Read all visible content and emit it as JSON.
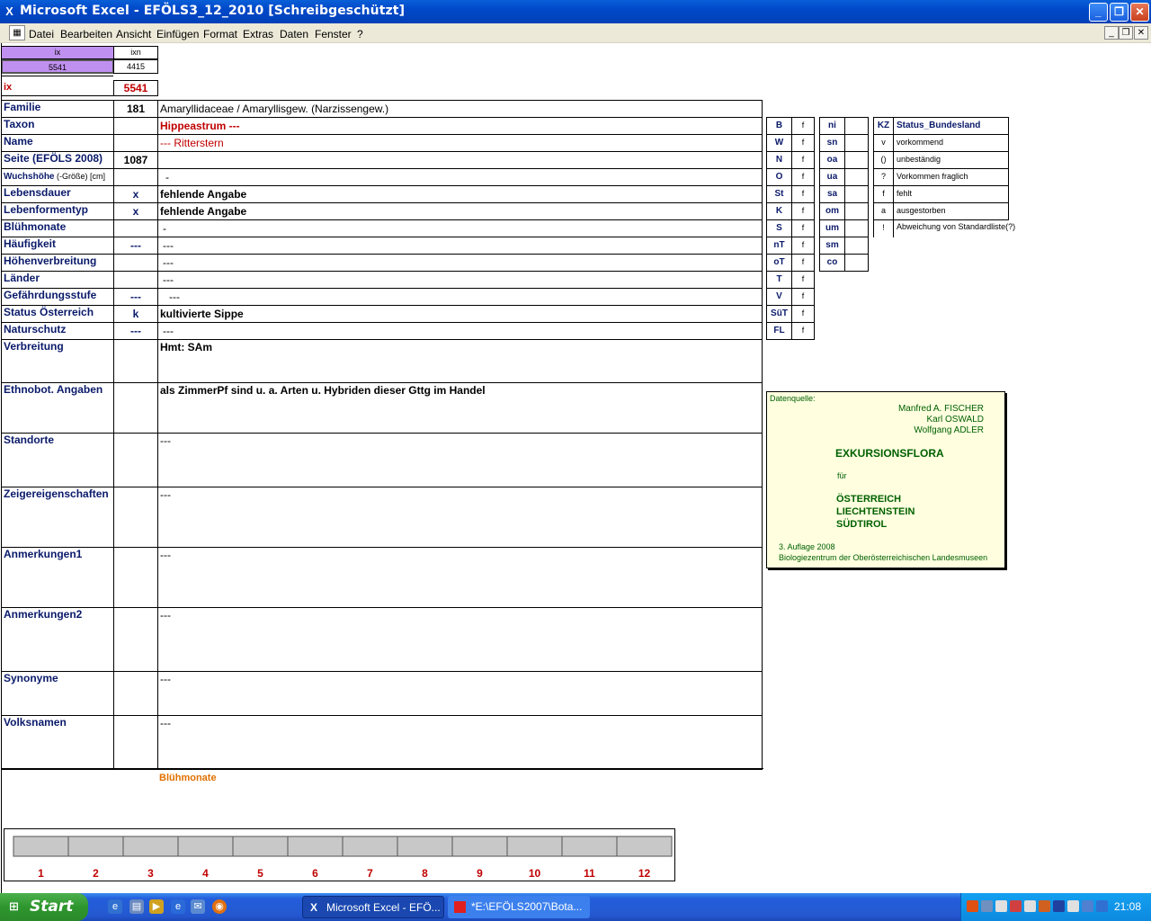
{
  "titlebar": {
    "title": "Microsoft Excel - EFÖLS3_12_2010  [Schreibgeschützt]",
    "app_icon": "excel-icon"
  },
  "menu": [
    "Datei",
    "Bearbeiten",
    "Ansicht",
    "Einfügen",
    "Format",
    "Extras",
    "Daten",
    "Fenster",
    "?"
  ],
  "index_box": {
    "ix_label": "ix",
    "ixn_label": "ixn",
    "ix_value": "5541",
    "ixn_value": "4415"
  },
  "ix_row": {
    "label": "ix",
    "value": "5541"
  },
  "rows": [
    {
      "label": "Familie",
      "code": "181",
      "value": "Amaryllidaceae  /  Amaryllisgew. (Narzissengew.)"
    },
    {
      "label": "Taxon",
      "code": "",
      "value": "Hippeastrum ---"
    },
    {
      "label": "Name",
      "code": "",
      "value": "--- Ritterstern"
    },
    {
      "label": "Seite (EFÖLS 2008)",
      "code": "1087",
      "value": ""
    },
    {
      "label": "Wuchshöhe",
      "label_suffix": " (-Größe) [cm]",
      "code": "",
      "value": "-"
    },
    {
      "label": "Lebensdauer",
      "code": "x",
      "value": "fehlende Angabe"
    },
    {
      "label": "Lebenformentyp",
      "code": "x",
      "value": "fehlende Angabe"
    },
    {
      "label": "Blühmonate",
      "code": "",
      "value": "-"
    },
    {
      "label": "Häufigkeit",
      "code": "---",
      "value": "---"
    },
    {
      "label": "Höhenverbreitung",
      "code": "",
      "value": "---"
    },
    {
      "label": "Länder",
      "code": "",
      "value": "---"
    },
    {
      "label": "Gefährdungsstufe",
      "code": "---",
      "value": "---"
    },
    {
      "label": "Status Österreich",
      "code": "k",
      "value": "kultivierte Sippe"
    },
    {
      "label": "Naturschutz",
      "code": "---",
      "value": "---"
    },
    {
      "label": "Verbreitung",
      "code": "",
      "value": "Hmt: SAm"
    },
    {
      "label": "Ethnobot. Angaben",
      "code": "",
      "value": "als ZimmerPf sind u. a. Arten u. Hybriden dieser Gttg im Handel"
    },
    {
      "label": "Standorte",
      "code": "",
      "value": "---"
    },
    {
      "label": "Zeigereigenschaften",
      "code": "",
      "value": "---"
    },
    {
      "label": "Anmerkungen1",
      "code": "",
      "value": "---"
    },
    {
      "label": "Anmerkungen2",
      "code": "",
      "value": "---"
    },
    {
      "label": "Synonyme",
      "code": "",
      "value": "---"
    },
    {
      "label": "Volksnamen",
      "code": "",
      "value": "---"
    }
  ],
  "states": [
    {
      "k": "B",
      "v": "f"
    },
    {
      "k": "W",
      "v": "f"
    },
    {
      "k": "N",
      "v": "f"
    },
    {
      "k": "O",
      "v": "f"
    },
    {
      "k": "St",
      "v": "f"
    },
    {
      "k": "K",
      "v": "f"
    },
    {
      "k": "S",
      "v": "f"
    },
    {
      "k": "nT",
      "v": "f"
    },
    {
      "k": "oT",
      "v": "f"
    },
    {
      "k": "T",
      "v": "f"
    },
    {
      "k": "V",
      "v": "f"
    },
    {
      "k": "SüT",
      "v": "f"
    },
    {
      "k": "FL",
      "v": "f"
    }
  ],
  "regions": [
    {
      "k": "ni",
      "v": ""
    },
    {
      "k": "sn",
      "v": ""
    },
    {
      "k": "oa",
      "v": ""
    },
    {
      "k": "ua",
      "v": ""
    },
    {
      "k": "sa",
      "v": ""
    },
    {
      "k": "om",
      "v": ""
    },
    {
      "k": "um",
      "v": ""
    },
    {
      "k": "sm",
      "v": ""
    },
    {
      "k": "co",
      "v": ""
    }
  ],
  "legend": {
    "header_kz": "KZ",
    "header_status": "Status_Bundesland",
    "items": [
      {
        "kz": "v",
        "text": "vorkommend"
      },
      {
        "kz": "()",
        "text": "unbeständig"
      },
      {
        "kz": "?",
        "text": "Vorkommen fraglich"
      },
      {
        "kz": "f",
        "text": "fehlt"
      },
      {
        "kz": "a",
        "text": "ausgestorben"
      },
      {
        "kz": "!",
        "text": "Abweichung von Standardliste(?)"
      }
    ]
  },
  "datasource": {
    "label": "Datenquelle:",
    "authors": [
      "Manfred A. FISCHER",
      "Karl OSWALD",
      "Wolfgang ADLER"
    ],
    "title": "EXKURSIONSFLORA",
    "fuer": "für",
    "countries": [
      "ÖSTERREICH",
      "LIECHTENSTEIN",
      "SÜDTIROL"
    ],
    "edition": "3. Auflage 2008",
    "publisher": "Biologiezentrum der Oberösterreichischen Landesmuseen"
  },
  "bloom": {
    "title": "Blühmonate",
    "months": [
      "1",
      "2",
      "3",
      "4",
      "5",
      "6",
      "7",
      "8",
      "9",
      "10",
      "11",
      "12"
    ],
    "chart_data": {
      "type": "bar",
      "categories": [
        "1",
        "2",
        "3",
        "4",
        "5",
        "6",
        "7",
        "8",
        "9",
        "10",
        "11",
        "12"
      ],
      "values": [
        0,
        0,
        0,
        0,
        0,
        0,
        0,
        0,
        0,
        0,
        0,
        0
      ]
    }
  },
  "taskbar": {
    "start": "Start",
    "tasks": [
      "Microsoft Excel - EFÖ...",
      "*E:\\EFÖLS2007\\Bota..."
    ],
    "clock": "21:08"
  }
}
